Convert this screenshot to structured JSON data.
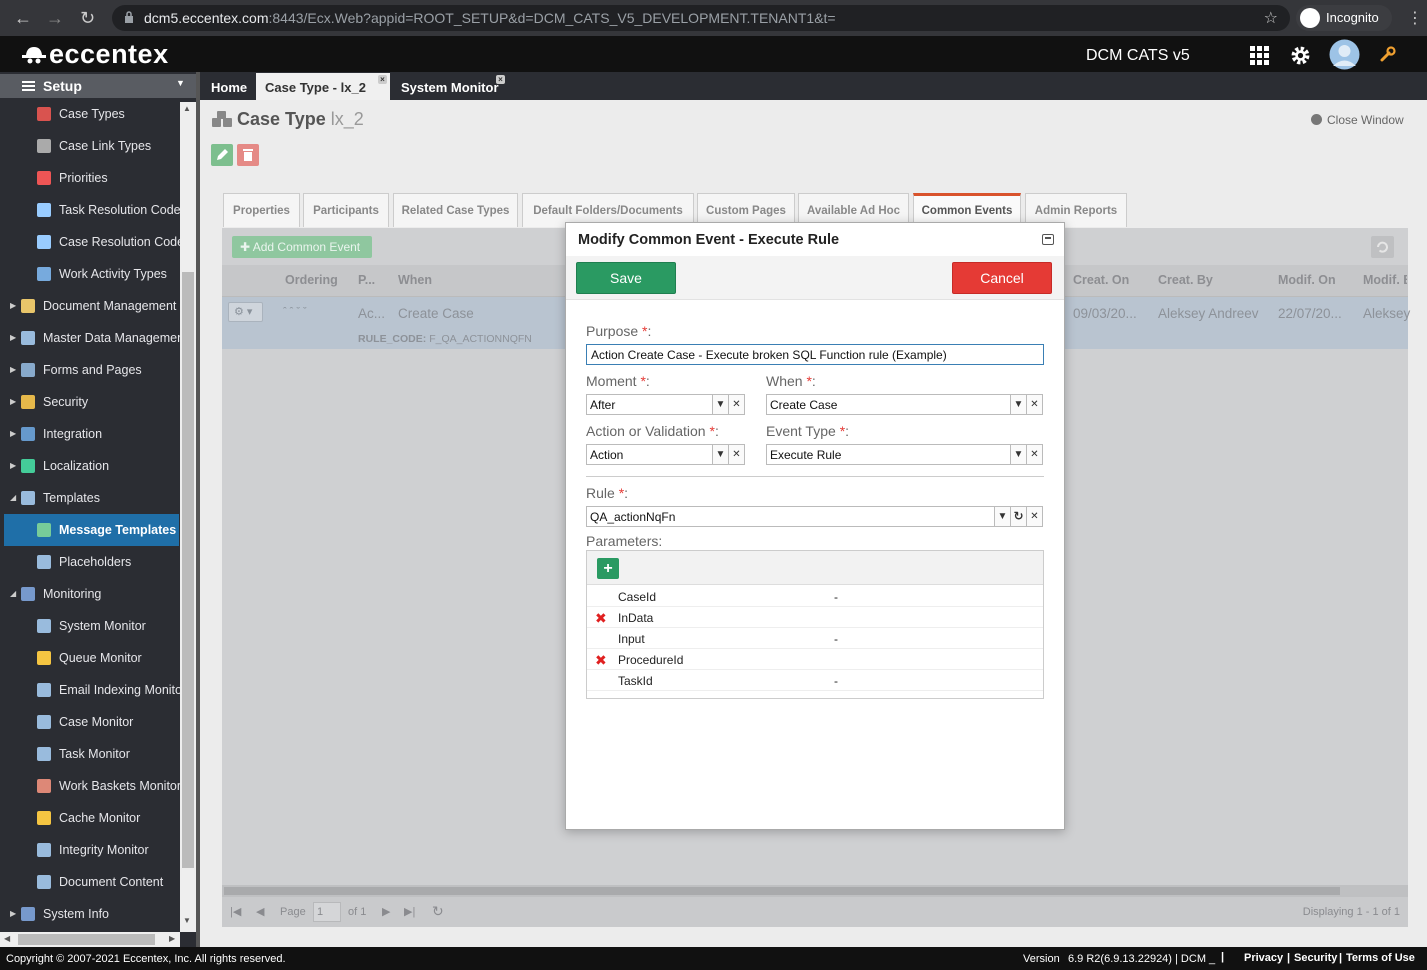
{
  "browser": {
    "url_host": "dcm5.eccentex.com",
    "url_rest": ":8443/Ecx.Web?appid=ROOT_SETUP&d=DCM_CATS_V5_DEVELOPMENT.TENANT1&t=",
    "incognito_label": "Incognito",
    "icons": [
      "back-icon",
      "forward-icon",
      "reload-icon",
      "lock-icon",
      "star-icon",
      "incognito-icon",
      "menu-icon"
    ]
  },
  "header": {
    "logo_text": "eccentex",
    "app_title": "DCM CATS v5",
    "icons": [
      "apps-grid-icon",
      "gear-icon",
      "avatar",
      "wrench-icon"
    ]
  },
  "sidebar": {
    "title": "Setup",
    "items": [
      {
        "label": "Case Types",
        "icon": "case-types-icon"
      },
      {
        "label": "Case Link Types",
        "icon": "link-icon"
      },
      {
        "label": "Priorities",
        "icon": "asterisk-icon"
      },
      {
        "label": "Task Resolution Codes",
        "icon": "tag-icon"
      },
      {
        "label": "Case Resolution Codes",
        "icon": "tag-icon"
      },
      {
        "label": "Work Activity Types",
        "icon": "activity-icon"
      },
      {
        "label": "Document Management",
        "icon": "folder-icon"
      },
      {
        "label": "Master Data Management",
        "icon": "table-icon"
      },
      {
        "label": "Forms and Pages",
        "icon": "form-icon"
      },
      {
        "label": "Security",
        "icon": "lock-icon"
      },
      {
        "label": "Integration",
        "icon": "plug-icon"
      },
      {
        "label": "Localization",
        "icon": "globe-icon"
      },
      {
        "label": "Templates",
        "icon": "template-icon"
      },
      {
        "label": "Message Templates",
        "icon": "message-icon"
      },
      {
        "label": "Placeholders",
        "icon": "placeholder-icon"
      },
      {
        "label": "Monitoring",
        "icon": "monitor-icon"
      },
      {
        "label": "System Monitor",
        "icon": "system-monitor-icon"
      },
      {
        "label": "Queue Monitor",
        "icon": "star-icon"
      },
      {
        "label": "Email Indexing Monitor",
        "icon": "email-icon"
      },
      {
        "label": "Case Monitor",
        "icon": "case-monitor-icon"
      },
      {
        "label": "Task Monitor",
        "icon": "task-monitor-icon"
      },
      {
        "label": "Work Baskets Monitor",
        "icon": "basket-icon"
      },
      {
        "label": "Cache Monitor",
        "icon": "lightning-icon"
      },
      {
        "label": "Integrity Monitor",
        "icon": "integrity-icon"
      },
      {
        "label": "Document Content",
        "icon": "document-icon"
      },
      {
        "label": "System Info",
        "icon": "terminal-icon"
      }
    ]
  },
  "page_tabs": [
    {
      "label": "Home"
    },
    {
      "label": "Case Type - lx_2"
    },
    {
      "label": "System Monitor"
    }
  ],
  "page": {
    "title": "Case Type",
    "subtitle": "lx_2",
    "close_window": "Close Window"
  },
  "detail_tabs": [
    "Properties",
    "Participants",
    "Related Case Types",
    "Default Folders/Documents",
    "Custom Pages",
    "Available Ad Hoc",
    "Common Events",
    "Admin Reports"
  ],
  "grid": {
    "add_button": "Add Common Event",
    "columns": [
      "Ordering",
      "P...",
      "When",
      "Creat. On",
      "Creat. By",
      "Modif. On",
      "Modif. By"
    ],
    "row": {
      "p": "Ac...",
      "when": "Create Case",
      "created_on": "09/03/20...",
      "created_by": "Aleksey Andreev",
      "modified_on": "22/07/20...",
      "modified_by": "Aleksey",
      "rule_code_label": "RULE_CODE:",
      "rule_code_value": "F_QA_ACTIONNQFN"
    },
    "pager": {
      "page_label": "Page",
      "page_value": "1",
      "of_label": "of 1",
      "displaying": "Displaying 1 - 1 of 1"
    }
  },
  "modal": {
    "title": "Modify Common Event - Execute Rule",
    "save": "Save",
    "cancel": "Cancel",
    "purpose_label": "Purpose",
    "purpose_value": "Action Create Case - Execute broken SQL Function rule (Example)",
    "moment_label": "Moment",
    "moment_value": "After",
    "when_label": "When",
    "when_value": "Create Case",
    "action_label": "Action or Validation",
    "action_value": "Action",
    "event_type_label": "Event Type",
    "event_type_value": "Execute Rule",
    "rule_label": "Rule",
    "rule_value": "QA_actionNqFn",
    "params_label": "Parameters:",
    "required_mark": "*",
    "colon": ":",
    "parameters": [
      {
        "name": "CaseId",
        "value": "-",
        "removable": false
      },
      {
        "name": "InData",
        "value": "",
        "removable": true
      },
      {
        "name": "Input",
        "value": "-",
        "removable": false
      },
      {
        "name": "ProcedureId",
        "value": "",
        "removable": true
      },
      {
        "name": "TaskId",
        "value": "-",
        "removable": false
      }
    ]
  },
  "footer": {
    "copyright": "Copyright © 2007-2021 Eccentex, Inc. All rights reserved.",
    "version_label": "Version",
    "version_value": "6.9 R2(6.9.13.22924) | DCM _",
    "links": [
      "Privacy",
      "Security",
      "Terms of Use"
    ]
  },
  "colors": {
    "accent_green": "#2a9a62",
    "cancel_red": "#e53a35",
    "active_blue": "#1f6fa8",
    "tab_orange": "#d9532c"
  }
}
